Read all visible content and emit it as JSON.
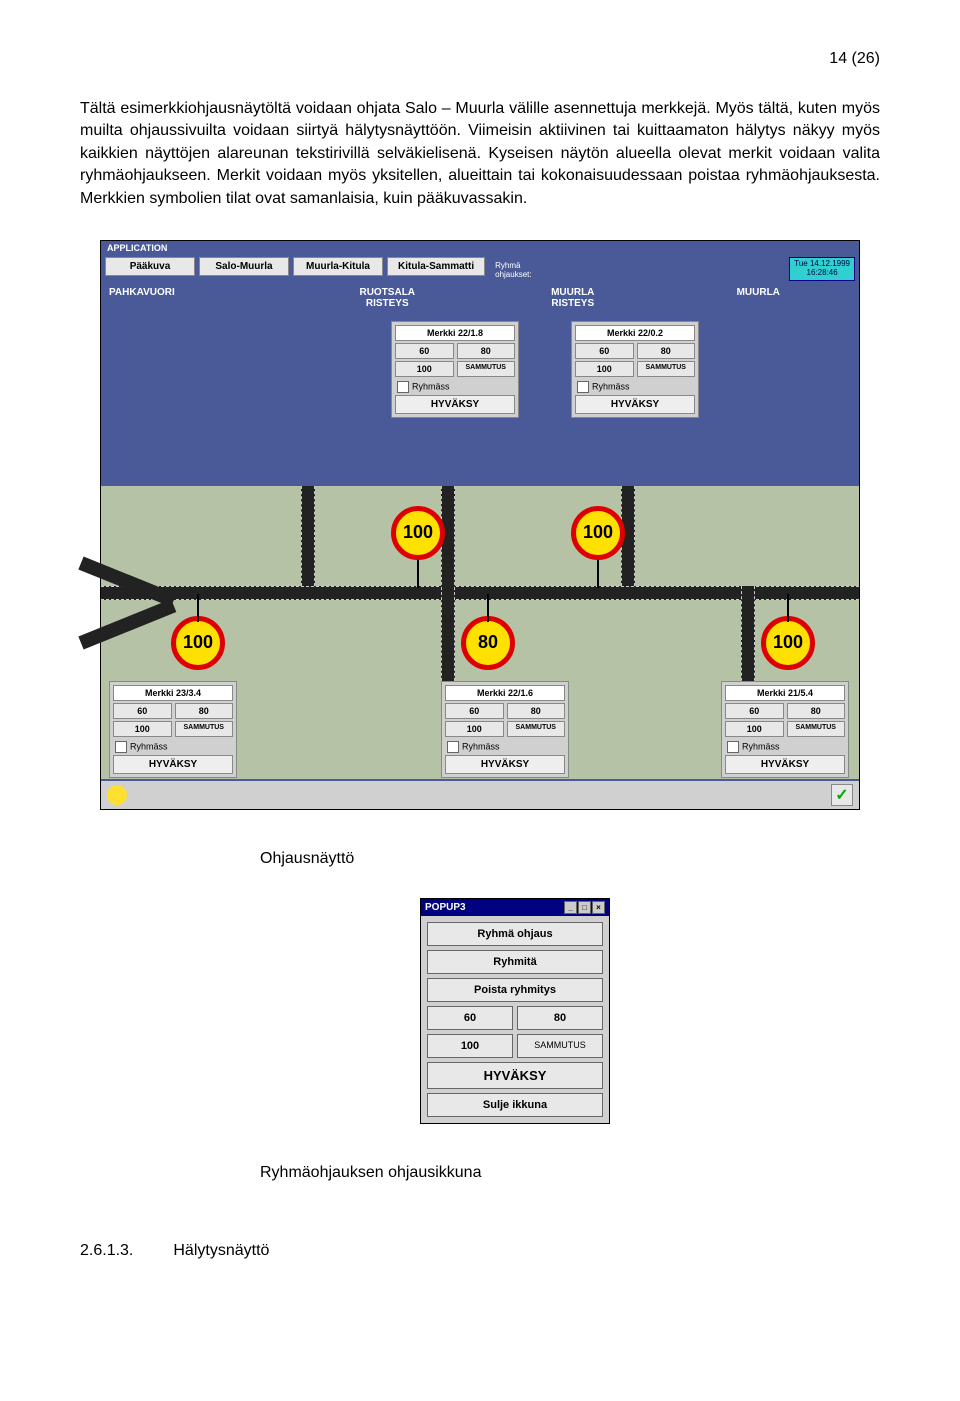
{
  "page_number": "14 (26)",
  "paragraph": "Tältä esimerkkiohjausnäytöltä voidaan ohjata Salo – Muurla välille asennettuja merkkejä. Myös tältä, kuten myös muilta ohjaussivuilta voidaan siirtyä hälytysnäyttöön. Viimeisin aktiivinen tai kuittaamaton hälytys näkyy myös kaikkien näyttöjen alareunan tekstirivillä selväkielisenä. Kyseisen näytön alueella olevat merkit voidaan valita ryhmäohjaukseen. Merkit voidaan myös yksitellen, alueittain tai kokonaisuudessaan poistaa ryhmäohjauksesta. Merkkien symbolien  tilat ovat samanlaisia, kuin pääkuvassakin.",
  "app": {
    "title": "APPLICATION",
    "tabs": [
      "Pääkuva",
      "Salo-Muurla",
      "Muurla-Kitula",
      "Kitula-Sammatti"
    ],
    "side_label": "Ryhmä\nohjaukset:",
    "date": "Tue 14.12.1999\n16:28:46",
    "locations": {
      "a": "PAHKAVUORI",
      "b": "RUOTSALA\nRISTEYS",
      "c": "MUURLA\nRISTEYS",
      "d": "MUURLA"
    }
  },
  "panels": {
    "top1": {
      "title": "Merkki 22/1.8",
      "b1": "60",
      "b2": "80",
      "b3": "100",
      "b4": "SAMMUTUS",
      "chk": "Ryhmäss",
      "accept": "HYVÄKSY"
    },
    "top2": {
      "title": "Merkki 22/0.2",
      "b1": "60",
      "b2": "80",
      "b3": "100",
      "b4": "SAMMUTUS",
      "chk": "Ryhmäss",
      "accept": "HYVÄKSY"
    },
    "bot1": {
      "title": "Merkki 23/3.4",
      "b1": "60",
      "b2": "80",
      "b3": "100",
      "b4": "SAMMUTUS",
      "chk": "Ryhmäss",
      "accept": "HYVÄKSY"
    },
    "bot2": {
      "title": "Merkki 22/1.6",
      "b1": "60",
      "b2": "80",
      "b3": "100",
      "b4": "SAMMUTUS",
      "chk": "Ryhmäss",
      "accept": "HYVÄKSY"
    },
    "bot3": {
      "title": "Merkki 21/5.4",
      "b1": "60",
      "b2": "80",
      "b3": "100",
      "b4": "SAMMUTUS",
      "chk": "Ryhmäss",
      "accept": "HYVÄKSY"
    }
  },
  "signs": {
    "s1": "100",
    "s2": "100",
    "s3": "100",
    "s4": "80",
    "s5": "100"
  },
  "caption1": "Ohjausnäyttö",
  "popup": {
    "title": "POPUP3",
    "items": [
      "Ryhmä ohjaus",
      "Ryhmitä",
      "Poista ryhmitys"
    ],
    "row1": [
      "60",
      "80"
    ],
    "row2": [
      "100",
      "SAMMUTUS"
    ],
    "accept": "HYVÄKSY",
    "close": "Sulje ikkuna"
  },
  "caption2": "Ryhmäohjauksen ohjausikkuna",
  "footer_num": "2.6.1.3.",
  "footer_title": "Hälytysnäyttö",
  "checkmark": "✓"
}
